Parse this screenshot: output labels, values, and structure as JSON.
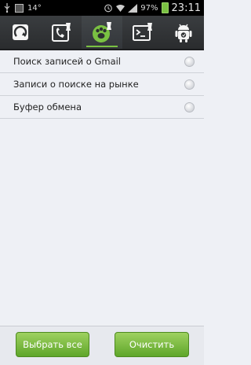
{
  "status": {
    "temp": "14°",
    "battery": "97%",
    "time": "23:11"
  },
  "tabs": [
    {
      "icon": "refresh-apps-icon",
      "active": false
    },
    {
      "icon": "call-log-clean-icon",
      "active": false
    },
    {
      "icon": "history-clean-icon",
      "active": true
    },
    {
      "icon": "terminal-clean-icon",
      "active": false
    },
    {
      "icon": "android-cleaner-icon",
      "active": false
    }
  ],
  "items": [
    {
      "label": "Поиск записей о Gmail"
    },
    {
      "label": "Записи о поиске на рынке"
    },
    {
      "label": "Буфер обмена"
    }
  ],
  "buttons": {
    "select_all": "Выбрать все",
    "clear": "Очистить"
  },
  "colors": {
    "accent": "#7ac142",
    "background": "#eef0f5"
  }
}
